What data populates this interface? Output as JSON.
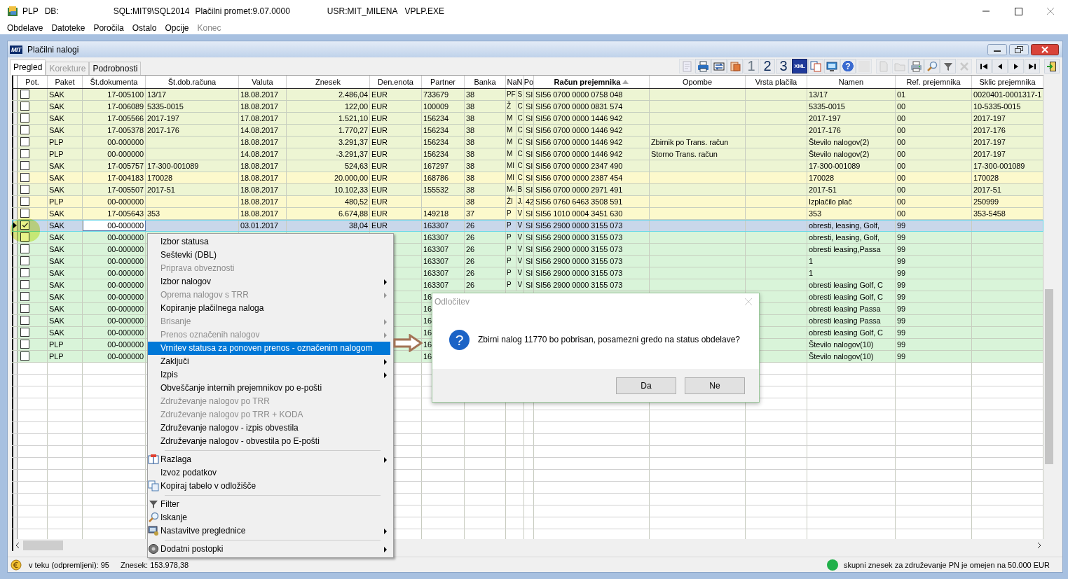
{
  "window": {
    "title_segments": [
      "PLP",
      "DB:",
      "SQL:MIT9\\SQL2014",
      "Plačilni promet:9.07.0000",
      "USR:MIT_MILENA",
      "VPLP.EXE"
    ]
  },
  "menubar": [
    {
      "label": "Obdelave",
      "disabled": false
    },
    {
      "label": "Datoteke",
      "disabled": false
    },
    {
      "label": "Poročila",
      "disabled": false
    },
    {
      "label": "Ostalo",
      "disabled": false
    },
    {
      "label": "Opcije",
      "disabled": false
    },
    {
      "label": "Konec",
      "disabled": true
    }
  ],
  "child_window": {
    "logo": "MIT",
    "title": "Plačilni nalogi"
  },
  "tabs": [
    {
      "label": "Pregled",
      "selected": true,
      "disabled": false
    },
    {
      "label": "Korekture",
      "selected": false,
      "disabled": true
    },
    {
      "label": "Podrobnosti",
      "selected": false,
      "disabled": false
    }
  ],
  "toolbar": [
    [
      {
        "disabled": true
      },
      {
        "disabled": false
      },
      {
        "disabled": false
      },
      {
        "disabled": false
      },
      {
        "label": "1",
        "disabled": true
      },
      {
        "label": "2",
        "disabled": false
      },
      {
        "label": "3",
        "disabled": false
      },
      {
        "label": "XML",
        "disabled": false
      },
      {
        "disabled": false
      },
      {
        "disabled": false
      },
      {
        "label": "?",
        "disabled": false
      },
      {
        "disabled": true
      }
    ],
    [
      {
        "disabled": true
      },
      {
        "disabled": true
      },
      {
        "disabled": false
      },
      {
        "disabled": false
      },
      {
        "disabled": false
      },
      {
        "disabled": true
      }
    ],
    [
      {
        "disabled": false
      },
      {
        "disabled": false
      },
      {
        "disabled": false
      },
      {
        "disabled": false
      }
    ],
    [
      {
        "disabled": false
      }
    ]
  ],
  "table": {
    "checkbox_column": {
      "label": "Pot."
    },
    "columns": [
      {
        "label": "Paket"
      },
      {
        "label": "Št.dokumenta"
      },
      {
        "label": "Št.dob.računa"
      },
      {
        "label": "Valuta"
      },
      {
        "label": "Znesek"
      },
      {
        "label": "Den.enota"
      },
      {
        "label": "Partner"
      },
      {
        "label": "Banka"
      },
      {
        "label": "NaN"
      },
      {
        "label": "Po"
      },
      {
        "label": "Račun prejemnika",
        "sorted": true
      },
      {
        "label": "Opombe"
      },
      {
        "label": "Vrsta plačila"
      },
      {
        "label": "Namen"
      },
      {
        "label": "Ref. prejemnika"
      },
      {
        "label": "Sklic prejemnika"
      }
    ],
    "rows": [
      {
        "selected": false,
        "checked": false,
        "editing": false,
        "color": "#edf5d3",
        "cells": [
          "SAK",
          "17-005100",
          "13/17",
          "18.08.2017",
          "2.486,04",
          "EUR",
          "733679",
          "38",
          [
            "PF",
            "S"
          ],
          "SI",
          "SI56 0700 0000 0758 048",
          null,
          null,
          "13/17",
          "01",
          "0020401-0001317-1"
        ]
      },
      {
        "selected": false,
        "checked": false,
        "editing": false,
        "color": "#edf5d3",
        "cells": [
          "SAK",
          "17-006089",
          "5335-0015",
          "18.08.2017",
          "122,00",
          "EUR",
          "100009",
          "38",
          [
            "Ž",
            "C"
          ],
          "SI",
          "SI56 0700 0000 0831 574",
          null,
          null,
          "5335-0015",
          "00",
          "10-5335-0015"
        ]
      },
      {
        "selected": false,
        "checked": false,
        "editing": false,
        "color": "#edf5d3",
        "cells": [
          "SAK",
          "17-005566",
          "2017-197",
          "17.08.2017",
          "1.521,10",
          "EUR",
          "156234",
          "38",
          [
            "M",
            "C"
          ],
          "SI",
          "SI56 0700 0000 1446 942",
          null,
          null,
          "2017-197",
          "00",
          "2017-197"
        ]
      },
      {
        "selected": false,
        "checked": false,
        "editing": false,
        "color": "#edf5d3",
        "cells": [
          "SAK",
          "17-005378",
          "2017-176",
          "14.08.2017",
          "1.770,27",
          "EUR",
          "156234",
          "38",
          [
            "M",
            "C"
          ],
          "SI",
          "SI56 0700 0000 1446 942",
          null,
          null,
          "2017-176",
          "00",
          "2017-176"
        ]
      },
      {
        "selected": false,
        "checked": false,
        "editing": false,
        "color": "#edf5d3",
        "cells": [
          "PLP",
          "00-000000",
          null,
          "18.08.2017",
          "3.291,37",
          "EUR",
          "156234",
          "38",
          [
            "M",
            "C"
          ],
          "SI",
          "SI56 0700 0000 1446 942",
          "Zbirnik po Trans. račun",
          null,
          "Število nalogov(2)",
          "00",
          "2017-197"
        ]
      },
      {
        "selected": false,
        "checked": false,
        "editing": false,
        "color": "#edf5d3",
        "cells": [
          "PLP",
          "00-000000",
          null,
          "14.08.2017",
          "-3.291,37",
          "EUR",
          "156234",
          "38",
          [
            "M",
            "C"
          ],
          "SI",
          "SI56 0700 0000 1446 942",
          "Storno Trans. račun",
          null,
          "Število nalogov(2)",
          "00",
          "2017-197"
        ]
      },
      {
        "selected": false,
        "checked": false,
        "editing": false,
        "color": "#edf5d3",
        "cells": [
          "SAK",
          "17-005757",
          "17-300-001089",
          "18.08.2017",
          "524,63",
          "EUR",
          "167297",
          "38",
          [
            "MI",
            "C"
          ],
          "SI",
          "SI56 0700 0000 2347 490",
          null,
          null,
          "17-300-001089",
          "00",
          "17-300-001089"
        ]
      },
      {
        "selected": false,
        "checked": false,
        "editing": false,
        "color": "#fcf9cc",
        "cells": [
          "SAK",
          "17-004183",
          "170028",
          "18.08.2017",
          "20.000,00",
          "EUR",
          "168786",
          "38",
          [
            "MI",
            "C"
          ],
          "SI",
          "SI56 0700 0000 2387 454",
          null,
          null,
          "170028",
          "00",
          "170028"
        ]
      },
      {
        "selected": false,
        "checked": false,
        "editing": false,
        "color": "#edf5d3",
        "cells": [
          "SAK",
          "17-005507",
          "2017-51",
          "18.08.2017",
          "10.102,33",
          "EUR",
          "155532",
          "38",
          [
            "M-",
            "B"
          ],
          "SI",
          "SI56 0700 0000 2971 491",
          null,
          null,
          "2017-51",
          "00",
          "2017-51"
        ]
      },
      {
        "selected": false,
        "checked": false,
        "editing": false,
        "color": "#fcf9cc",
        "cells": [
          "PLP",
          "00-000000",
          null,
          "18.08.2017",
          "480,52",
          "EUR",
          null,
          "38",
          [
            "ŽI",
            "J."
          ],
          "42",
          "SI56 0760 6463 3508 591",
          null,
          null,
          "Izplačilo plač",
          "00",
          "250999"
        ]
      },
      {
        "selected": false,
        "checked": false,
        "editing": false,
        "color": "#fcf9cc",
        "cells": [
          "SAK",
          "17-005643",
          "353",
          "18.08.2017",
          "6.674,88",
          "EUR",
          "149218",
          "37",
          [
            "P",
            "V"
          ],
          "SI",
          "SI56 1010 0004 3451 630",
          null,
          null,
          "353",
          "00",
          "353-5458"
        ]
      },
      {
        "selected": true,
        "checked": true,
        "editing": true,
        "color": "#c9d7ea",
        "cells": [
          "SAK",
          "00-000000",
          null,
          "03.01.2017",
          "38,04",
          "EUR",
          "163307",
          "26",
          [
            "P",
            "V"
          ],
          "SI",
          "SI56 2900 0000 3155 073",
          null,
          null,
          "obresti, leasing, Golf,",
          "99",
          null
        ]
      },
      {
        "selected": false,
        "checked": false,
        "editing": false,
        "color": "#d9f4d9",
        "cells": [
          "SAK",
          "00-000000",
          null,
          null,
          null,
          null,
          "163307",
          "26",
          [
            "P",
            "V"
          ],
          "SI",
          "SI56 2900 0000 3155 073",
          null,
          null,
          "obresti, leasing, Golf,",
          "99",
          null
        ]
      },
      {
        "selected": false,
        "checked": false,
        "editing": false,
        "color": "#d9f4d9",
        "cells": [
          "SAK",
          "00-000000",
          null,
          null,
          null,
          null,
          "163307",
          "26",
          [
            "P",
            "V"
          ],
          "SI",
          "SI56 2900 0000 3155 073",
          null,
          null,
          "obresti leasing,Passa",
          "99",
          null
        ]
      },
      {
        "selected": false,
        "checked": false,
        "editing": false,
        "color": "#d9f4d9",
        "cells": [
          "SAK",
          "00-000000",
          null,
          null,
          null,
          null,
          "163307",
          "26",
          [
            "P",
            "V"
          ],
          "SI",
          "SI56 2900 0000 3155 073",
          null,
          null,
          "1",
          "99",
          null
        ]
      },
      {
        "selected": false,
        "checked": false,
        "editing": false,
        "color": "#d9f4d9",
        "cells": [
          "SAK",
          "00-000000",
          null,
          null,
          null,
          null,
          "163307",
          "26",
          [
            "P",
            "V"
          ],
          "SI",
          "SI56 2900 0000 3155 073",
          null,
          null,
          "1",
          "99",
          null
        ]
      },
      {
        "selected": false,
        "checked": false,
        "editing": false,
        "color": "#d9f4d9",
        "cells": [
          "SAK",
          "00-000000",
          null,
          null,
          null,
          null,
          "163307",
          "26",
          [
            "P",
            "V"
          ],
          "SI",
          "SI56 2900 0000 3155 073",
          null,
          null,
          "obresti leasing Golf, C",
          "99",
          null
        ]
      },
      {
        "selected": false,
        "checked": false,
        "editing": false,
        "color": "#d9f4d9",
        "cells": [
          "SAK",
          "00-000000",
          null,
          null,
          null,
          null,
          "16",
          null,
          null,
          null,
          null,
          null,
          null,
          "obresti leasing Golf, C",
          "99",
          null
        ]
      },
      {
        "selected": false,
        "checked": false,
        "editing": false,
        "color": "#d9f4d9",
        "cells": [
          "SAK",
          "00-000000",
          null,
          null,
          null,
          null,
          "16",
          null,
          null,
          null,
          null,
          null,
          null,
          "obresti leasing Passa",
          "99",
          null
        ]
      },
      {
        "selected": false,
        "checked": false,
        "editing": false,
        "color": "#d9f4d9",
        "cells": [
          "SAK",
          "00-000000",
          null,
          null,
          null,
          null,
          "16",
          null,
          null,
          null,
          null,
          null,
          null,
          "obresti leasing Passa",
          "99",
          null
        ]
      },
      {
        "selected": false,
        "checked": false,
        "editing": false,
        "color": "#d9f4d9",
        "cells": [
          "SAK",
          "00-000000",
          null,
          null,
          null,
          null,
          "16",
          null,
          null,
          null,
          null,
          null,
          null,
          "obresti leasing Golf, C",
          "99",
          null
        ]
      },
      {
        "selected": false,
        "checked": false,
        "editing": false,
        "color": "#d9f4d9",
        "cells": [
          "PLP",
          "00-000000",
          null,
          null,
          null,
          null,
          "16",
          null,
          null,
          null,
          null,
          null,
          null,
          "Število nalogov(10)",
          "99",
          null
        ]
      },
      {
        "selected": false,
        "checked": false,
        "editing": false,
        "color": "#d9f4d9",
        "cells": [
          "PLP",
          "00-000000",
          null,
          null,
          null,
          null,
          "16",
          null,
          null,
          null,
          null,
          null,
          null,
          "Število nalogov(10)",
          "99",
          null
        ]
      }
    ]
  },
  "context_menu": [
    {
      "kind": "item",
      "label": "Izbor statusa",
      "disabled": false,
      "submenu": false,
      "selected": false
    },
    {
      "kind": "item",
      "label": "Seštevki (DBL)",
      "disabled": false,
      "submenu": false,
      "selected": false
    },
    {
      "kind": "item",
      "label": "Priprava obveznosti",
      "disabled": true,
      "submenu": false,
      "selected": false
    },
    {
      "kind": "item",
      "label": "Izbor nalogov",
      "disabled": false,
      "submenu": true,
      "selected": false
    },
    {
      "kind": "item",
      "label": "Oprema nalogov s TRR",
      "disabled": true,
      "submenu": true,
      "selected": false
    },
    {
      "kind": "item",
      "label": "Kopiranje plačilnega naloga",
      "disabled": false,
      "submenu": false,
      "selected": false
    },
    {
      "kind": "item",
      "label": "Brisanje",
      "disabled": true,
      "submenu": true,
      "selected": false
    },
    {
      "kind": "item",
      "label": "Prenos označenih nalogov",
      "disabled": true,
      "submenu": true,
      "selected": false
    },
    {
      "kind": "item",
      "label": "Vrnitev statusa za ponoven prenos - označenim nalogom",
      "disabled": false,
      "submenu": false,
      "selected": true
    },
    {
      "kind": "item",
      "label": "Zaključi",
      "disabled": false,
      "submenu": true,
      "selected": false
    },
    {
      "kind": "item",
      "label": "Izpis",
      "disabled": false,
      "submenu": true,
      "selected": false
    },
    {
      "kind": "item",
      "label": "Obveščanje internih prejemnikov po e-pošti",
      "disabled": false,
      "submenu": false,
      "selected": false
    },
    {
      "kind": "item",
      "label": "Združevanje nalogov po TRR",
      "disabled": true,
      "submenu": false,
      "selected": false
    },
    {
      "kind": "item",
      "label": "Združevanje nalogov po TRR + KODA",
      "disabled": true,
      "submenu": false,
      "selected": false
    },
    {
      "kind": "item",
      "label": "Združevanje nalogov - izpis obvestila",
      "disabled": false,
      "submenu": false,
      "selected": false
    },
    {
      "kind": "item",
      "label": "Združevanje nalogov - obvestila po E-pošti",
      "disabled": false,
      "submenu": false,
      "selected": false
    },
    {
      "kind": "separator"
    },
    {
      "kind": "item",
      "label": "Razlaga",
      "disabled": false,
      "submenu": true,
      "selected": false,
      "icon": true
    },
    {
      "kind": "item",
      "label": "Izvoz podatkov",
      "disabled": false,
      "submenu": false,
      "selected": false
    },
    {
      "kind": "item",
      "label": "Kopiraj tabelo v odložišče",
      "disabled": false,
      "submenu": false,
      "selected": false,
      "icon": true
    },
    {
      "kind": "separator"
    },
    {
      "kind": "item",
      "label": "Filter",
      "disabled": false,
      "submenu": false,
      "selected": false,
      "icon": true
    },
    {
      "kind": "item",
      "label": "Iskanje",
      "disabled": false,
      "submenu": false,
      "selected": false,
      "icon": true
    },
    {
      "kind": "item",
      "label": "Nastavitve preglednice",
      "disabled": false,
      "submenu": true,
      "selected": false,
      "icon": true
    },
    {
      "kind": "separator"
    },
    {
      "kind": "item",
      "label": "Dodatni postopki",
      "disabled": false,
      "submenu": true,
      "selected": false,
      "icon": true
    }
  ],
  "dialog": {
    "title": "Odločitev",
    "icon": "?",
    "message": "Zbirni nalog 11770 bo pobrisan, posamezni gredo na status obdelave?",
    "buttons": [
      "Da",
      "Ne"
    ]
  },
  "status_bar": {
    "count": "v teku (odpremljeni): 95",
    "total": "Znesek: 153.978,38",
    "indicator": {
      "color": "#20b04a"
    },
    "notice": "skupni znesek za združevanje PN je omejen na 50.000 EUR"
  }
}
